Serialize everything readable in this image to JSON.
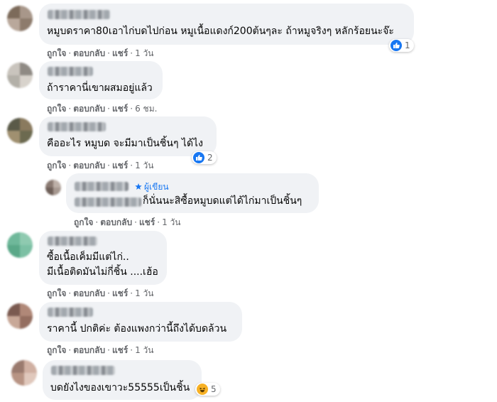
{
  "action_labels": {
    "like": "ถูกใจ",
    "reply": "ตอบกลับ",
    "share": "แชร์",
    "separator": "·"
  },
  "author_badge": "ผู้เขียน",
  "comments": [
    {
      "lines": [
        "หมูบดราคา80เอาไก่บดไปก่อน หมูเนื้อแดงก์200ต้นๆละ ถ้าหมูจริงๆ หลักร้อยนะจ๊ะ"
      ],
      "time": "1 วัน",
      "reaction": {
        "type": "like",
        "count": "1"
      }
    },
    {
      "lines": [
        "ถ้าราคานี่เขาผสมอยู่แล้ว"
      ],
      "time": "6 ชม."
    },
    {
      "lines": [
        "คืออะไร หมูบด จะมีมาเป็นชิ้นๆ ได้ไง"
      ],
      "time": "1 วัน",
      "reaction": {
        "type": "like",
        "count": "2"
      }
    },
    {
      "lines": [
        "ก็นั่นนะสิซื้อหมูบดแต่ได้ไก่มาเป็นชิ้นๆ"
      ],
      "time": "1 วัน"
    },
    {
      "lines": [
        "ซื้อเนื้อเค็มมีแต่ไก่..",
        "มีเนื้อติดมันไม่กี่ชิ้น ....เฮ้อ"
      ],
      "time": "1 วัน"
    },
    {
      "lines": [
        "ราคานี้ ปกติค่ะ ต้องแพงกว่านี้ถึงได้บดล้วน"
      ],
      "time": "1 วัน"
    },
    {
      "lines": [
        "บดยังไงของเขาวะ55555เป็นชิ้น"
      ],
      "reaction": {
        "type": "haha",
        "count": "5"
      }
    }
  ]
}
